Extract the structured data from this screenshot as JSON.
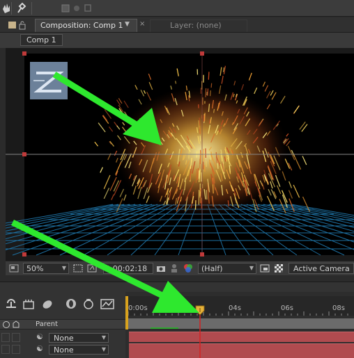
{
  "panel": {
    "comp_tab": "Composition: Comp 1",
    "layer_tab": "Layer: (none)",
    "breadcrumb": "Comp 1"
  },
  "viewer_bar": {
    "magnification": "50%",
    "timecode": "0:00:02:18",
    "resolution": "(Half)",
    "view": "Active Camera"
  },
  "timeline": {
    "ruler_labels": [
      "0:00s",
      "04s",
      "06s",
      "08s"
    ],
    "parent_header": "Parent",
    "layers": [
      {
        "parent": "None"
      },
      {
        "parent": "None"
      }
    ]
  },
  "colors": {
    "annotation_arrow": "#2ee82e",
    "current_time_indicator": "#d32323",
    "layer_bar": "#b04b4f",
    "particle_core": "#f7e37a",
    "grid": "#1d6fa0"
  }
}
